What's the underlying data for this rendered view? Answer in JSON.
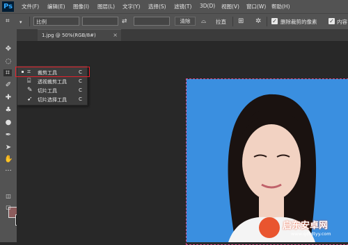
{
  "app": {
    "logo": "Ps"
  },
  "menubar": {
    "items": [
      "文件(F)",
      "编辑(E)",
      "图像(I)",
      "图层(L)",
      "文字(Y)",
      "选择(S)",
      "滤镜(T)",
      "3D(D)",
      "视图(V)",
      "窗口(W)",
      "帮助(H)"
    ]
  },
  "options": {
    "ratio_value": "比例",
    "clear_label": "清除",
    "straighten_label": "拉直",
    "delete_pixels_label": "删除裁剪的像素",
    "content_aware_label": "内容",
    "delete_pixels_checked": true,
    "content_aware_checked": true
  },
  "document": {
    "tab_title": "1.jpg @ 50%(RGB/8#)",
    "close": "×"
  },
  "flyout": {
    "items": [
      {
        "label": "裁剪工具",
        "shortcut": "C",
        "icon": "crop-icon",
        "active": true
      },
      {
        "label": "透视裁剪工具",
        "shortcut": "C",
        "icon": "perspective-crop-icon"
      },
      {
        "label": "切片工具",
        "shortcut": "C",
        "icon": "slice-icon"
      },
      {
        "label": "切片选择工具",
        "shortcut": "C",
        "icon": "slice-select-icon"
      }
    ]
  },
  "colors": {
    "foreground": "#8c5c5c",
    "background": "#111111",
    "photo_bg": "#3a8fe0",
    "highlight": "#e6202a"
  },
  "watermark": {
    "title": "启东安卓网",
    "url": "www.qdtdtyy.com"
  }
}
